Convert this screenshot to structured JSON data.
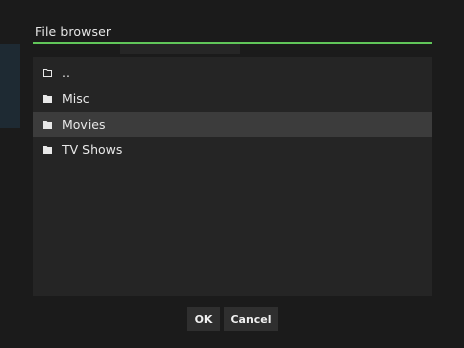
{
  "dialog": {
    "title": "File browser",
    "accent_color": "#61c65a"
  },
  "file_list": {
    "items": [
      {
        "label": "..",
        "icon": "folder-outline-icon",
        "selected": false
      },
      {
        "label": "Misc",
        "icon": "folder-icon",
        "selected": false
      },
      {
        "label": "Movies",
        "icon": "folder-icon",
        "selected": true
      },
      {
        "label": "TV Shows",
        "icon": "folder-icon",
        "selected": false
      }
    ]
  },
  "buttons": {
    "ok_label": "OK",
    "cancel_label": "Cancel"
  }
}
